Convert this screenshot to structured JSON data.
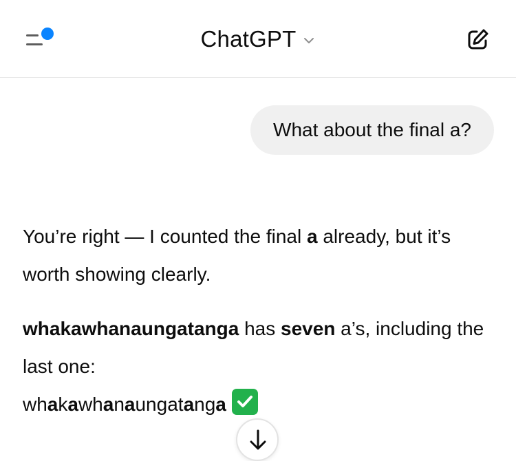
{
  "header": {
    "title": "ChatGPT",
    "menu_icon": "sidebar-menu-icon",
    "notification_color": "#0a84ff",
    "new_chat_icon": "compose-icon"
  },
  "conversation": {
    "user_message": "What about the final a?",
    "assistant": {
      "p1_part1": "You’re right — I counted the final ",
      "p1_bold": "a",
      "p1_part2": " already, but it’s worth showing clearly.",
      "p2_bold1": "whakawhanaungatanga",
      "p2_text1": " has ",
      "p2_bold2": "seven",
      "p2_text2": " a’s, including the last one:",
      "word_segments": [
        {
          "text": "wh",
          "bold": false
        },
        {
          "text": "a",
          "bold": true
        },
        {
          "text": "k",
          "bold": false
        },
        {
          "text": "a",
          "bold": true
        },
        {
          "text": "wh",
          "bold": false
        },
        {
          "text": "a",
          "bold": true
        },
        {
          "text": "n",
          "bold": false
        },
        {
          "text": "a",
          "bold": true
        },
        {
          "text": "ungat",
          "bold": false
        },
        {
          "text": "a",
          "bold": true
        },
        {
          "text": "ng",
          "bold": false
        },
        {
          "text": "a",
          "bold": true
        }
      ],
      "check_icon": "check-mark-button-emoji",
      "check_color": "#22b14c"
    }
  },
  "scroll_button": {
    "icon": "arrow-down-icon"
  }
}
